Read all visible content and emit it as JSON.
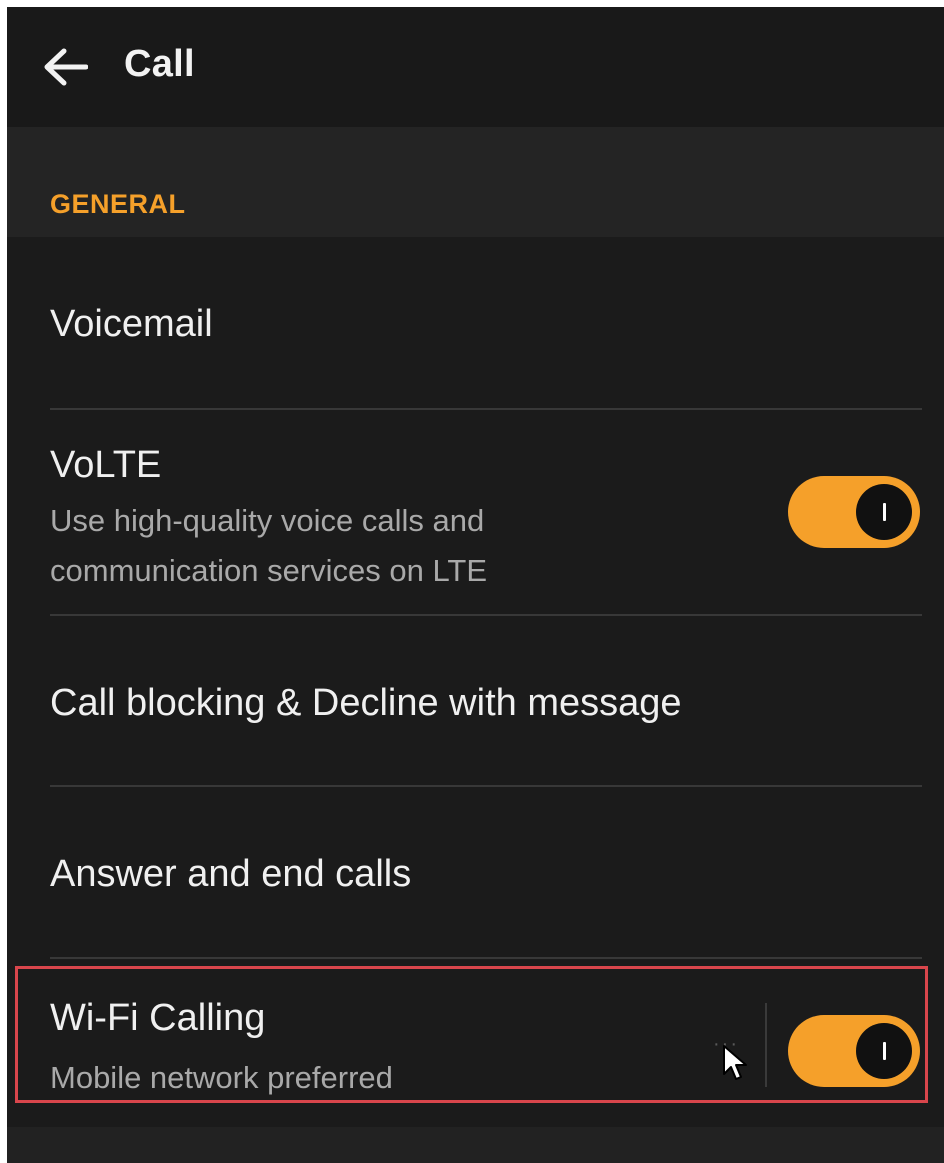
{
  "header": {
    "back_icon": "arrow-left-icon",
    "title": "Call"
  },
  "section": {
    "label": "GENERAL"
  },
  "items": [
    {
      "title": "Voicemail"
    },
    {
      "title": "VoLTE",
      "subtitle": "Use high-quality voice calls and communication services on LTE",
      "toggle_on": true
    },
    {
      "title": "Call blocking & Decline with message"
    },
    {
      "title": "Answer and end calls"
    },
    {
      "title": "Wi-Fi Calling",
      "subtitle": "Mobile network preferred",
      "toggle_on": true
    }
  ],
  "colors": {
    "accent": "#f5a02a",
    "background": "#1b1b1b",
    "highlight_border": "#d9464c"
  }
}
